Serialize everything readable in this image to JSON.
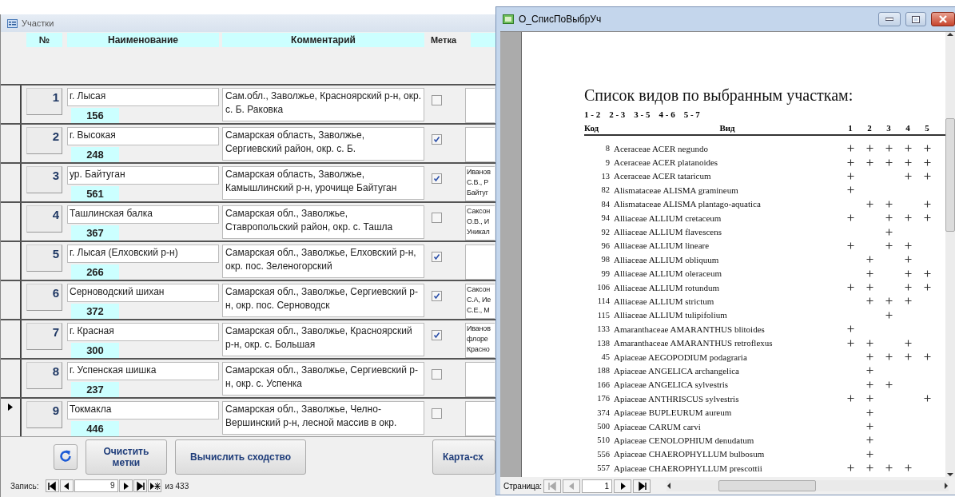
{
  "form_window": {
    "title": "Участки",
    "columns": [
      "№",
      "Наименование",
      "Комментарий",
      "Метка"
    ],
    "rows": [
      {
        "number": "1",
        "name": "г. Лысая",
        "count": "156",
        "comment": "Сам.обл., Заволжье, Красноярский р-н, окр. с. Б. Раковка",
        "checked": false,
        "current": false
      },
      {
        "number": "2",
        "name": "г. Высокая",
        "count": "248",
        "comment": "Самарская область, Заволжье, Сергиевский район, окр. с. Б.",
        "checked": true,
        "current": false
      },
      {
        "number": "3",
        "name": "ур. Байтуган",
        "count": "561",
        "comment": "Самарская область, Заволжье, Камышлинский р-н, урочище Байтуган",
        "checked": true,
        "current": false,
        "column_5": [
          "Иванов",
          "С.В., Р",
          "Байтуг"
        ]
      },
      {
        "number": "4",
        "name": "Ташлинская балка",
        "count": "367",
        "comment": "Самарская обл., Заволжье, Ставропольский район, окр. с. Ташла",
        "checked": false,
        "current": false,
        "column_5": [
          "Саксон",
          "О.В., И",
          "Уникал"
        ]
      },
      {
        "number": "5",
        "name": "г. Лысая (Елховский р-н)",
        "count": "266",
        "comment": "Самарская обл., Заволжье, Елховский р-н, окр. пос. Зеленогорский",
        "checked": true,
        "current": false
      },
      {
        "number": "6",
        "name": "Серноводский шихан",
        "count": "372",
        "comment": "Самарская обл., Заволжье, Сергиевский р-н, окр. пос. Серноводск",
        "checked": true,
        "current": false,
        "column_5": [
          "Саксон",
          "С.А, Ие",
          "С.Е., М"
        ]
      },
      {
        "number": "7",
        "name": "г. Красная",
        "count": "300",
        "comment": "Самарская обл., Заволжье, Красноярский р-н, окр. с. Большая",
        "checked": true,
        "current": false,
        "column_5": [
          "Иванов",
          "флоре",
          "Красно"
        ]
      },
      {
        "number": "8",
        "name": "г. Успенская шишка",
        "count": "237",
        "comment": "Самарская обл., Заволжье, Сергиевский р-н, окр. с. Успенка",
        "checked": false,
        "current": false
      },
      {
        "number": "9",
        "name": "Токмакла",
        "count": "446",
        "comment": "Самарская обл., Заволжье, Челно-Вершинский р-н, лесной массив в окр.",
        "checked": false,
        "current": true
      }
    ],
    "buttons": [
      {
        "kind": "refresh"
      },
      {
        "kind": "text",
        "label": "Очистить метки"
      },
      {
        "kind": "text",
        "label": "Вычислить сходство"
      },
      {
        "kind": "text",
        "label": "Карта-сх"
      }
    ],
    "navigator": {
      "label": "Запись:",
      "value": "9",
      "total": "из 433"
    }
  },
  "report_window": {
    "title": "О_СписПоВыбрУч",
    "report_title": "Список видов по выбранным участкам:",
    "pairs": [
      "1 - 2",
      "2 - 3",
      "3 - 5",
      "4 - 6",
      "5 - 7"
    ],
    "columns": {
      "code": "Код",
      "species": "Вид",
      "sites": [
        "1",
        "2",
        "3",
        "4",
        "5"
      ]
    },
    "species": [
      {
        "code": "8",
        "name": "Aceraceae ACER negundo",
        "marks": [
          true,
          true,
          true,
          true,
          true
        ]
      },
      {
        "code": "9",
        "name": "Aceraceae ACER platanoides",
        "marks": [
          true,
          true,
          true,
          true,
          true
        ]
      },
      {
        "code": "13",
        "name": "Aceraceae ACER tataricum",
        "marks": [
          true,
          false,
          false,
          true,
          true
        ]
      },
      {
        "code": "82",
        "name": "Alismataceae ALISMA gramineum",
        "marks": [
          true,
          false,
          false,
          false,
          false
        ]
      },
      {
        "code": "84",
        "name": "Alismataceae ALISMA plantago-aquatica",
        "marks": [
          false,
          true,
          true,
          false,
          true
        ]
      },
      {
        "code": "94",
        "name": "Alliaceae ALLIUM cretaceum",
        "marks": [
          true,
          false,
          true,
          true,
          true
        ]
      },
      {
        "code": "92",
        "name": "Alliaceae ALLIUM flavescens",
        "marks": [
          false,
          false,
          true,
          false,
          false
        ]
      },
      {
        "code": "96",
        "name": "Alliaceae ALLIUM lineare",
        "marks": [
          true,
          false,
          true,
          true,
          false
        ]
      },
      {
        "code": "98",
        "name": "Alliaceae ALLIUM obliquum",
        "marks": [
          false,
          true,
          false,
          true,
          false
        ]
      },
      {
        "code": "99",
        "name": "Alliaceae ALLIUM oleraceum",
        "marks": [
          false,
          true,
          false,
          true,
          true
        ]
      },
      {
        "code": "106",
        "name": "Alliaceae ALLIUM rotundum",
        "marks": [
          true,
          true,
          false,
          true,
          true
        ]
      },
      {
        "code": "114",
        "name": "Alliaceae ALLIUM strictum",
        "marks": [
          false,
          true,
          true,
          true,
          false
        ]
      },
      {
        "code": "115",
        "name": "Alliaceae ALLIUM tulipifolium",
        "marks": [
          false,
          false,
          true,
          false,
          false
        ]
      },
      {
        "code": "133",
        "name": "Amaranthaceae AMARANTHUS blitoides",
        "marks": [
          true,
          false,
          false,
          false,
          false
        ]
      },
      {
        "code": "138",
        "name": "Amaranthaceae AMARANTHUS retroflexus",
        "marks": [
          true,
          true,
          false,
          true,
          false
        ]
      },
      {
        "code": "45",
        "name": "Apiaceae AEGOPODIUM podagraria",
        "marks": [
          false,
          true,
          true,
          true,
          true
        ]
      },
      {
        "code": "188",
        "name": "Apiaceae ANGELICA archangelica",
        "marks": [
          false,
          true,
          false,
          false,
          false
        ]
      },
      {
        "code": "166",
        "name": "Apiaceae ANGELICA sylvestris",
        "marks": [
          false,
          true,
          true,
          false,
          false
        ]
      },
      {
        "code": "176",
        "name": "Apiaceae ANTHRISCUS sylvestris",
        "marks": [
          true,
          true,
          false,
          false,
          true
        ]
      },
      {
        "code": "374",
        "name": "Apiaceae BUPLEURUM aureum",
        "marks": [
          false,
          true,
          false,
          false,
          false
        ]
      },
      {
        "code": "500",
        "name": "Apiaceae CARUM carvi",
        "marks": [
          false,
          true,
          false,
          false,
          false
        ]
      },
      {
        "code": "510",
        "name": "Apiaceae CENOLOPHIUM denudatum",
        "marks": [
          false,
          true,
          false,
          false,
          false
        ]
      },
      {
        "code": "556",
        "name": "Apiaceae CHAEROPHYLLUM bulbosum",
        "marks": [
          false,
          true,
          false,
          false,
          false
        ]
      },
      {
        "code": "557",
        "name": "Apiaceae CHAEROPHYLLUM prescottii",
        "marks": [
          true,
          true,
          true,
          true,
          false
        ]
      }
    ],
    "navigator": {
      "label": "Страница:",
      "value": "1"
    }
  }
}
